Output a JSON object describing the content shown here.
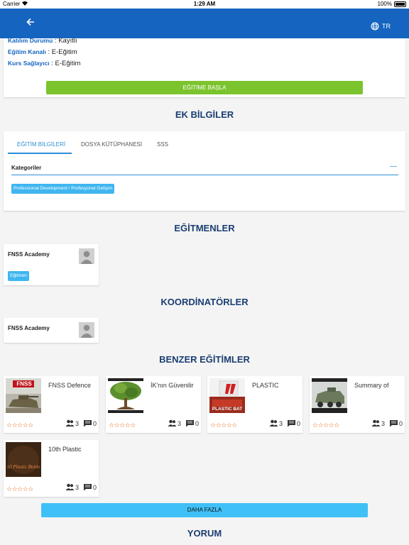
{
  "status_bar": {
    "carrier": "Carrier",
    "time": "1:29 AM",
    "battery": "100%"
  },
  "nav": {
    "language": "TR"
  },
  "course_info": {
    "rows": [
      {
        "key": "Katılım Durumu",
        "value": "Kayıtlı"
      },
      {
        "key": "Eğitim Kanalı",
        "value": "E-Eğitim"
      },
      {
        "key": "Kurs Sağlayıcı",
        "value": "E-Eğitim"
      }
    ],
    "start_button": "EĞİTİME BAŞLA"
  },
  "extra_info": {
    "title": "EK BİLGİLER",
    "tabs": [
      {
        "label": "EĞİTİM BİLGİLERİ",
        "active": true
      },
      {
        "label": "DOSYA KÜTÜPHANESİ",
        "active": false
      },
      {
        "label": "SSS",
        "active": false
      }
    ],
    "categories_label": "Kategoriler",
    "collapse_symbol": "—",
    "category_chip": "Professional Development / Profesyonel Gelişim"
  },
  "instructors": {
    "title": "EĞİTMENLER",
    "items": [
      {
        "name": "FNSS Academy",
        "role": "Eğitmen"
      }
    ]
  },
  "coordinators": {
    "title": "KOORDİNATÖRLER",
    "items": [
      {
        "name": "FNSS Academy"
      }
    ]
  },
  "similar": {
    "title": "BENZER EĞİTİMLER",
    "courses": [
      {
        "title": "FNSS Defence",
        "thumb_text": "FNSS",
        "participants": "3",
        "comments": "0",
        "rating": 0
      },
      {
        "title": "İK'nın Güvenilir",
        "thumb_text": "",
        "participants": "3",
        "comments": "0",
        "rating": 0
      },
      {
        "title": "PLASTIC",
        "thumb_text": "PLASTIC BAT",
        "participants": "3",
        "comments": "0",
        "rating": 0
      },
      {
        "title": "Summary of",
        "thumb_text": "",
        "participants": "3",
        "comments": "0",
        "rating": 0
      },
      {
        "title": "10th Plastic",
        "thumb_text": "10 Plastic Bottle",
        "participants": "3",
        "comments": "0",
        "rating": 0
      }
    ],
    "more_button": "DAHA FAZLA"
  },
  "comments": {
    "title": "YORUM"
  },
  "colors": {
    "nav": "#1565c0",
    "accent": "#2d8fd8",
    "start_button": "#7cc42e",
    "chip": "#3fb6f0",
    "section_title": "#1a3e72",
    "star": "#e06010"
  },
  "icons": {
    "back": "arrow-left-icon",
    "language": "globe-icon",
    "participants": "people-icon",
    "comments": "comment-icon",
    "avatar": "person-silhouette-icon",
    "rating": "star-outline-icon"
  }
}
